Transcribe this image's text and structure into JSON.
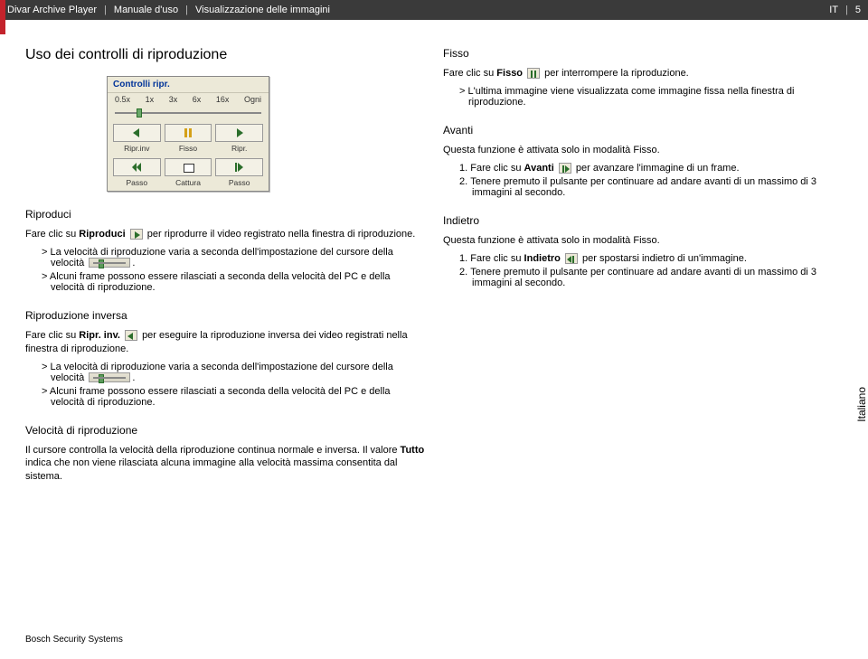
{
  "header": {
    "product": "Divar Archive Player",
    "doc": "Manuale d'uso",
    "section": "Visualizzazione delle immagini",
    "lang": "IT",
    "page": "5"
  },
  "panel": {
    "title": "Controlli ripr.",
    "speeds": [
      "0.5x",
      "1x",
      "3x",
      "6x",
      "16x",
      "Ogni"
    ],
    "labels1": [
      "Ripr.inv",
      "Fisso",
      "Ripr."
    ],
    "labels2": [
      "Passo",
      "Cattura",
      "Passo"
    ]
  },
  "left": {
    "h1": "Uso dei controlli di riproduzione",
    "riproduci": {
      "h": "Riproduci",
      "p1a": "Fare clic su ",
      "p1b": "Riproduci",
      "p1c": " per riprodurre il video registrato nella finestra di riproduzione.",
      "li1a": "La velocità di riproduzione varia a seconda dell'impostazione del cursore della velocità ",
      "li1b": ".",
      "li2": "Alcuni frame possono essere rilasciati a seconda della velocità del PC e della velocità di riproduzione."
    },
    "inversa": {
      "h": "Riproduzione inversa",
      "p1a": "Fare clic su ",
      "p1b": "Ripr. inv.",
      "p1c": " per eseguire la riproduzione inversa dei video registrati nella finestra di riproduzione.",
      "li1a": "La velocità di riproduzione varia a seconda dell'impostazione del cursore della velocità ",
      "li1b": ".",
      "li2": "Alcuni frame possono essere rilasciati a seconda della velocità del PC e della velocità di riproduzione."
    },
    "velocita": {
      "h": "Velocità di riproduzione",
      "p1a": "Il cursore controlla la velocità della riproduzione continua normale e inversa. Il valore ",
      "p1b": "Tutto",
      "p1c": " indica che non viene rilasciata alcuna immagine alla velocità massima consentita dal sistema."
    }
  },
  "right": {
    "fisso": {
      "h": "Fisso",
      "p1a": "Fare clic su ",
      "p1b": "Fisso",
      "p1c": " per interrompere la riproduzione.",
      "li1": "L'ultima immagine viene visualizzata come immagine fissa nella finestra di riproduzione."
    },
    "avanti": {
      "h": "Avanti",
      "p1": "Questa funzione è attivata solo in modalità Fisso.",
      "o1n": "1.",
      "o1a": "Fare clic su ",
      "o1b": "Avanti",
      "o1c": " per avanzare l'immagine di un frame.",
      "o2n": "2.",
      "o2": "Tenere premuto il pulsante per continuare ad andare avanti di un massimo di 3 immagini al secondo."
    },
    "indietro": {
      "h": "Indietro",
      "p1": "Questa funzione è attivata solo in modalità Fisso.",
      "o1n": "1.",
      "o1a": "Fare clic su ",
      "o1b": "Indietro",
      "o1c": " per spostarsi indietro di un'immagine.",
      "o2n": "2.",
      "o2": "Tenere premuto il pulsante per continuare ad andare avanti di un massimo di 3 immagini al secondo."
    }
  },
  "side_tab": "Italiano",
  "footer": "Bosch Security Systems"
}
